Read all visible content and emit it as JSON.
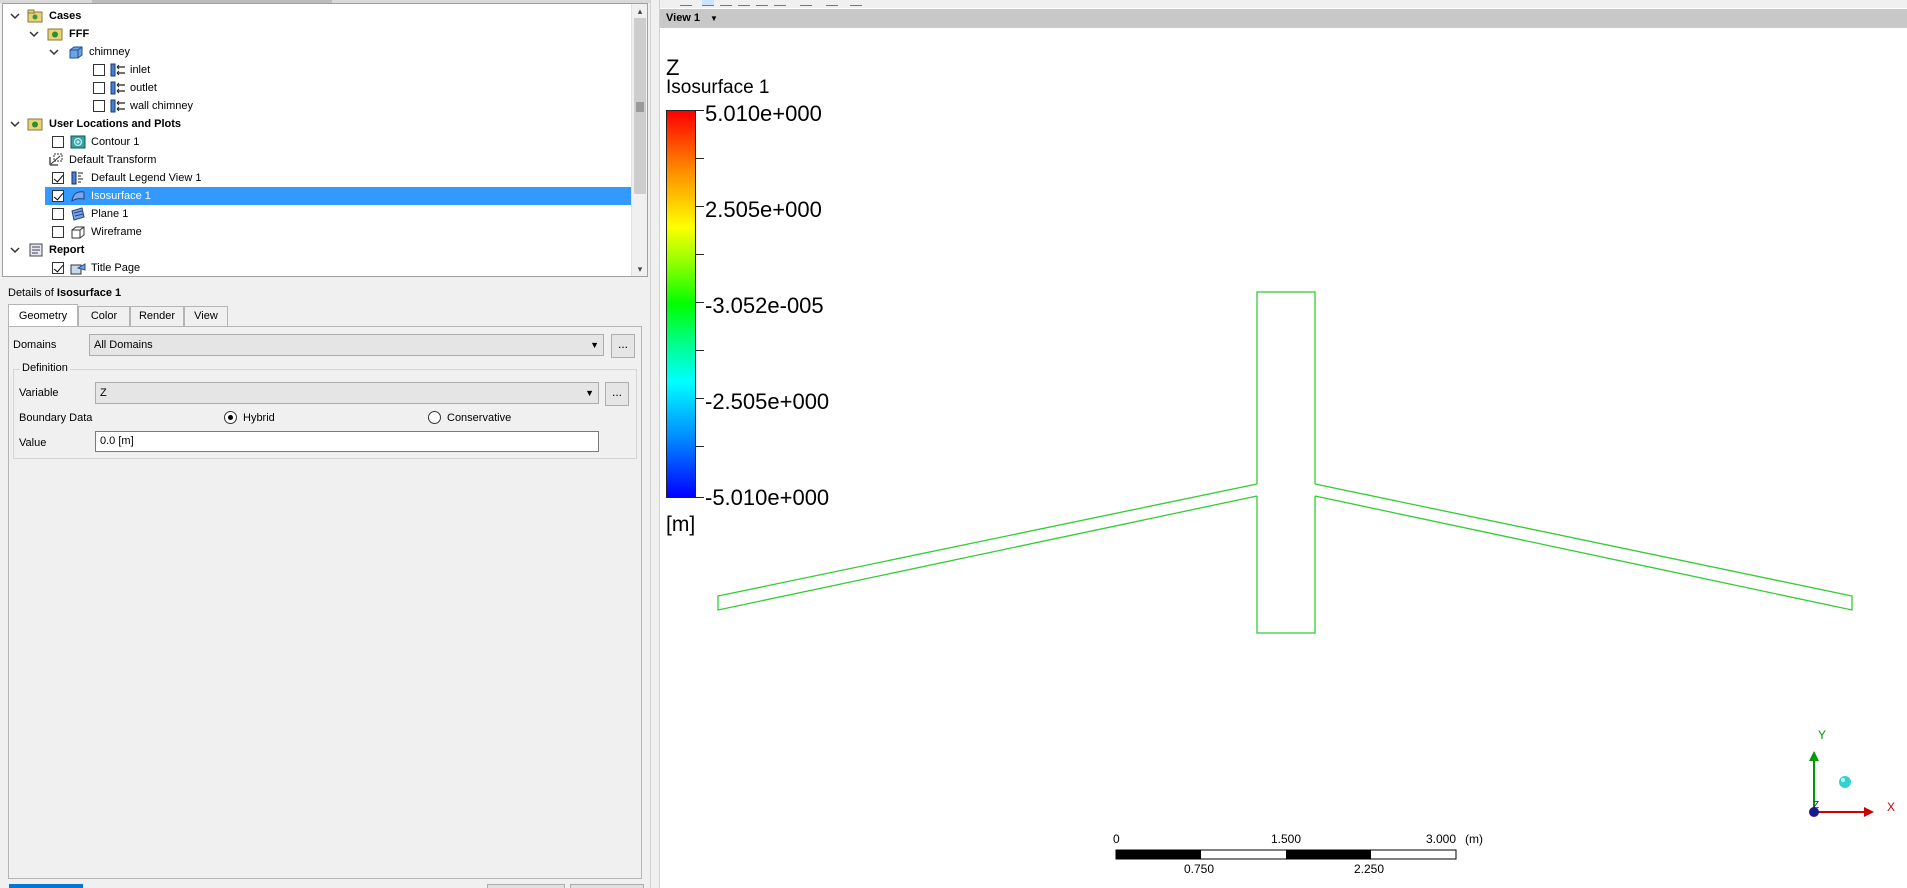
{
  "tree": {
    "items": [
      {
        "label": "Cases",
        "bold": true
      },
      {
        "label": "FFF",
        "bold": true
      },
      {
        "label": "chimney"
      },
      {
        "label": "inlet",
        "checked": false
      },
      {
        "label": "outlet",
        "checked": false
      },
      {
        "label": "wall chimney",
        "checked": false
      },
      {
        "label": "User Locations and Plots",
        "bold": true
      },
      {
        "label": "Contour 1",
        "checked": false
      },
      {
        "label": "Default Transform"
      },
      {
        "label": "Default Legend View 1",
        "checked": true
      },
      {
        "label": "Isosurface 1",
        "checked": true,
        "selected": true
      },
      {
        "label": "Plane 1",
        "checked": false
      },
      {
        "label": "Wireframe",
        "checked": false
      },
      {
        "label": "Report",
        "bold": true
      },
      {
        "label": "Title Page",
        "checked": true
      }
    ]
  },
  "details": {
    "prefix": "Details of ",
    "object": "Isosurface 1",
    "tabs": [
      "Geometry",
      "Color",
      "Render",
      "View"
    ],
    "active_tab": "Geometry",
    "domains_label": "Domains",
    "domains_value": "All Domains",
    "ellipsis": "...",
    "definition_label": "Definition",
    "variable_label": "Variable",
    "variable_value": "Z",
    "boundary_label": "Boundary Data",
    "hybrid_label": "Hybrid",
    "conservative_label": "Conservative",
    "boundary_selected": "Hybrid",
    "value_label": "Value",
    "value_value": "0.0 [m]"
  },
  "viewer": {
    "view_label": "View 1",
    "legend": {
      "variable": "Z",
      "name": "Isosurface 1",
      "ticks": [
        "5.010e+000",
        "2.505e+000",
        "-3.052e-005",
        "-2.505e+000",
        "-5.010e+000"
      ],
      "unit": "[m]"
    },
    "scale": {
      "top_labels": [
        "0",
        "1.500",
        "3.000"
      ],
      "unit": "(m)",
      "bottom_labels": [
        "0.750",
        "2.250"
      ]
    },
    "axes": {
      "x": "X",
      "y": "Y",
      "z": "Z"
    },
    "colors": {
      "geometry_line": "#33cc33",
      "selection": "#3399ff",
      "axis_x": "#cc0000",
      "axis_y": "#009900",
      "axis_z": "#0000aa"
    }
  }
}
